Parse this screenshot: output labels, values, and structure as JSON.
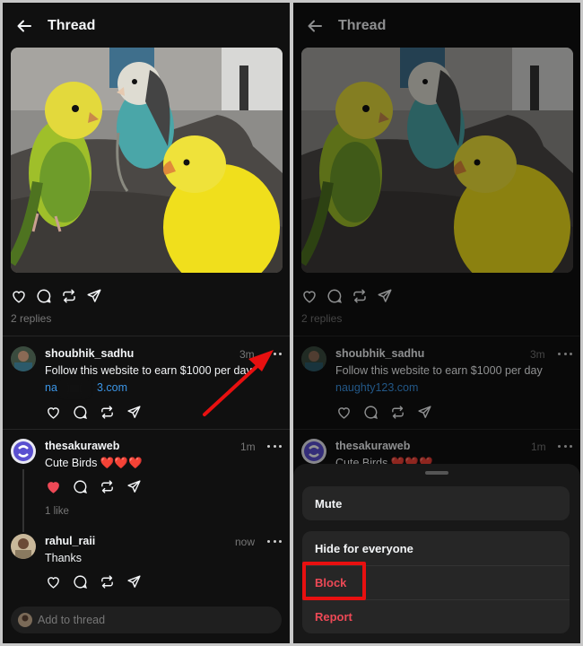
{
  "header": {
    "title": "Thread"
  },
  "post": {
    "replies_count": "2 replies"
  },
  "replies": [
    {
      "username": "shoubhik_sadhu",
      "time": "3m",
      "text_truncated": "Follow this website to earn $1000 per day",
      "text": "Follow this website to earn $1000 per day",
      "link_left": "na",
      "link_right": "3.com",
      "link_full": "naughty123.com"
    },
    {
      "username": "thesakuraweb",
      "time": "1m",
      "text": "Cute Birds",
      "hearts": "❤️❤️❤️",
      "likes": "1 like",
      "liked": true
    },
    {
      "username": "rahul_raii",
      "time": "now",
      "text": "Thanks"
    }
  ],
  "composer": {
    "placeholder": "Add to thread"
  },
  "menu": {
    "mute": "Mute",
    "hide": "Hide for everyone",
    "block": "Block",
    "report": "Report"
  },
  "colors": {
    "background": "#101010",
    "link": "#3b95e6",
    "danger": "#ed4956",
    "annotation": "#e81010"
  },
  "icons": [
    "back-arrow-icon",
    "heart-icon",
    "comment-icon",
    "repost-icon",
    "share-icon",
    "more-icon"
  ]
}
